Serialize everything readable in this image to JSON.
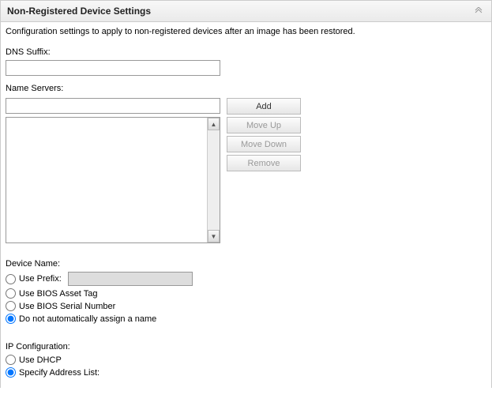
{
  "panel": {
    "title": "Non-Registered Device Settings"
  },
  "description": "Configuration settings to apply to non-registered devices after an image has been restored.",
  "dns": {
    "label": "DNS Suffix:",
    "value": ""
  },
  "nameServers": {
    "label": "Name Servers:",
    "inputValue": "",
    "addLabel": "Add",
    "moveUpLabel": "Move Up",
    "moveDownLabel": "Move Down",
    "removeLabel": "Remove",
    "items": []
  },
  "deviceName": {
    "label": "Device Name:",
    "options": {
      "usePrefix": "Use Prefix:",
      "biosAssetTag": "Use BIOS Asset Tag",
      "biosSerial": "Use BIOS Serial Number",
      "noAuto": "Do not automatically assign a name"
    },
    "prefixValue": "",
    "selected": "noAuto"
  },
  "ipConfig": {
    "label": "IP Configuration:",
    "options": {
      "dhcp": "Use DHCP",
      "specify": "Specify Address List:"
    },
    "selected": "specify"
  }
}
